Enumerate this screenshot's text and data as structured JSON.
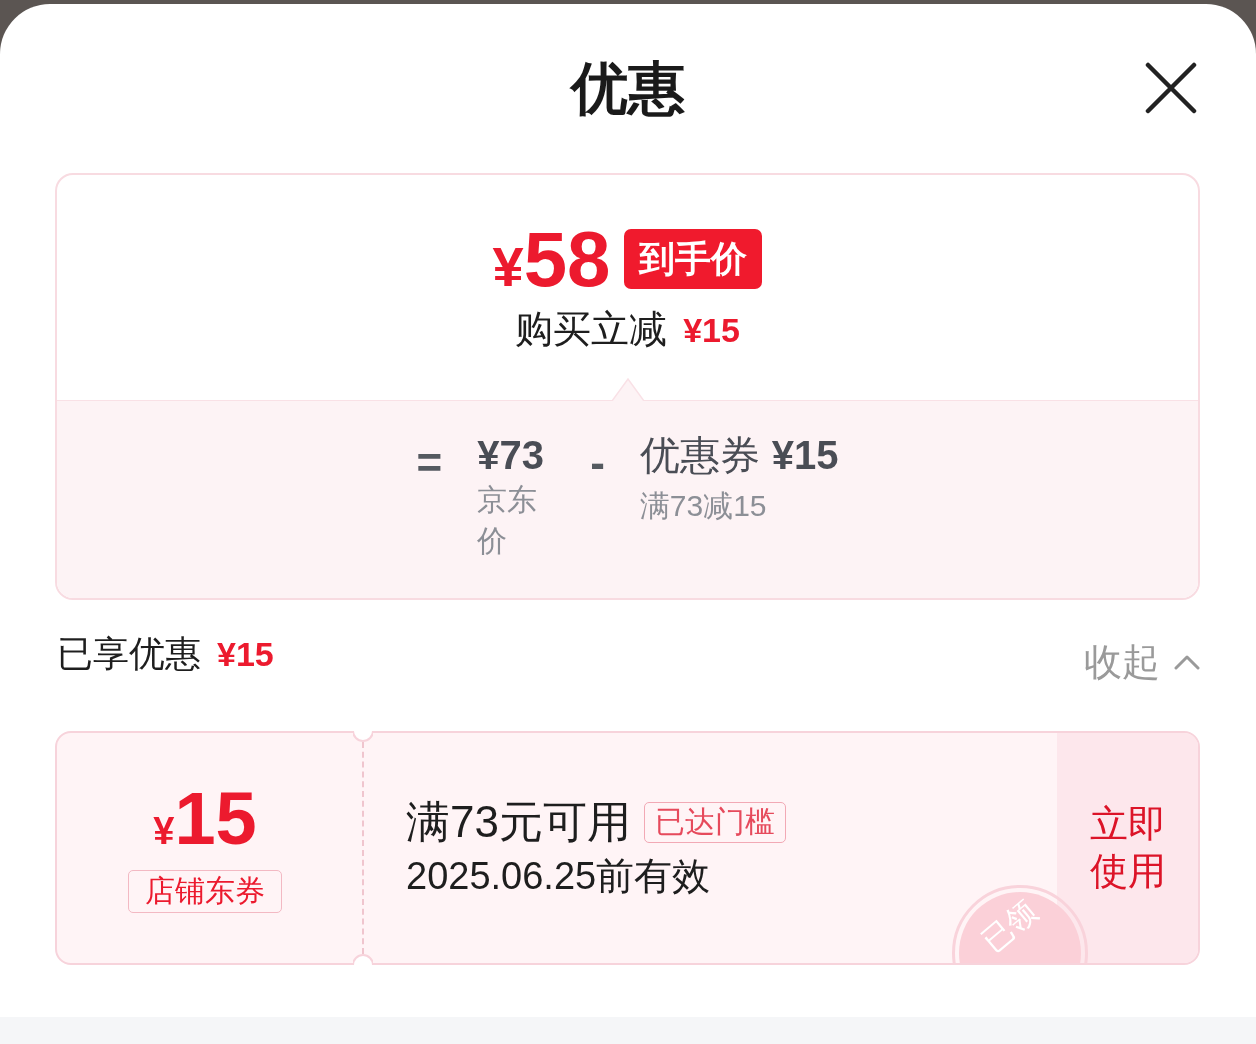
{
  "sheet": {
    "title": "优惠"
  },
  "price_summary": {
    "currency": "¥",
    "amount": "58",
    "badge": "到手价",
    "saving_label": "购买立减",
    "saving_amount": "¥15"
  },
  "breakdown": {
    "equals": "=",
    "base": {
      "amount": "¥73",
      "label": "京东价"
    },
    "operator": "-",
    "discount": {
      "name": "优惠券",
      "amount": "¥15",
      "condition": "满73减15"
    }
  },
  "savings": {
    "label": "已享优惠",
    "amount": "¥15",
    "toggle": {
      "label": "收起",
      "expanded": true
    }
  },
  "coupons": [
    {
      "currency": "¥",
      "amount": "15",
      "tag": "店铺东券",
      "condition": "满73元可用",
      "status": "已达门槛",
      "validity": "2025.06.25前有效",
      "action": "立即使用",
      "stamp": "已领"
    }
  ]
}
